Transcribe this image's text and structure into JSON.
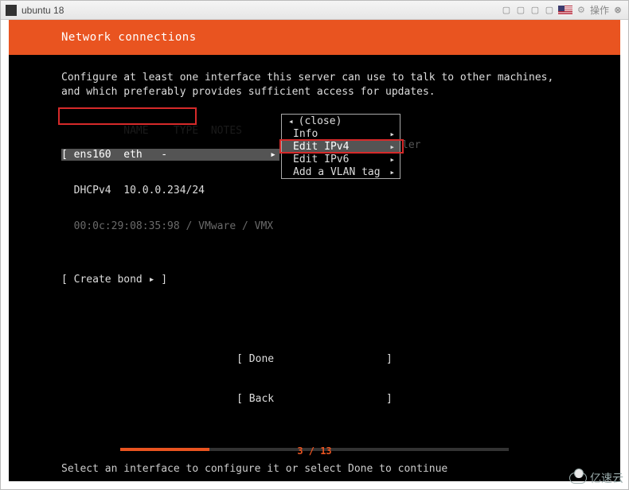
{
  "titlebar": {
    "title": "ubuntu 18",
    "action_label": "操作"
  },
  "page": {
    "header": "Network connections",
    "description_l1": "Configure at least one interface this server can use to talk to other machines,",
    "description_l2": "and which preferably provides sufficient access for updates.",
    "columns": "  NAME    TYPE  NOTES",
    "iface_row": "[ ens160  eth   -",
    "dhcp_row": "  DHCPv4  10.0.0.234/24",
    "mac_row": "  00:0c:29:08:35:98 / VMware / VMX",
    "trailing": "ler",
    "create_bond": "[ Create bond ▸ ]"
  },
  "popup": {
    "items": [
      {
        "label": "(close)",
        "has_submenu": false,
        "has_back": true
      },
      {
        "label": "Info",
        "has_submenu": true,
        "has_back": false
      },
      {
        "label": "Edit IPv4",
        "has_submenu": true,
        "has_back": false
      },
      {
        "label": "Edit IPv6",
        "has_submenu": true,
        "has_back": false
      },
      {
        "label": "Add a VLAN tag",
        "has_submenu": true,
        "has_back": false
      }
    ],
    "selected_index": 2
  },
  "footer": {
    "done": "[ Done                  ]",
    "back": "[ Back                  ]",
    "help": "Select an interface to configure it or select Done to continue"
  },
  "progress": {
    "current": 3,
    "total": 13,
    "label": "3 / 13",
    "percent": 23
  },
  "watermark": "亿速云"
}
